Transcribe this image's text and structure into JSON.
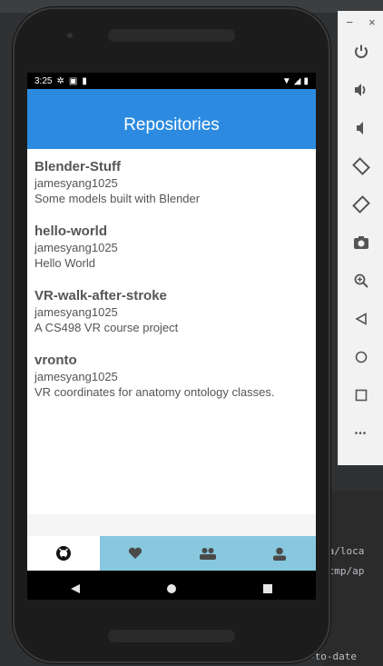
{
  "ide": {
    "log_lines": [
      "ta/loca",
      "/tmp/ap"
    ],
    "bottom_text": "-to-date"
  },
  "status_bar": {
    "time": "3:25"
  },
  "app_bar": {
    "title": "Repositories"
  },
  "repositories": [
    {
      "name": "Blender-Stuff",
      "owner": "jamesyang1025",
      "description": "Some models built with Blender"
    },
    {
      "name": "hello-world",
      "owner": "jamesyang1025",
      "description": "Hello World"
    },
    {
      "name": "VR-walk-after-stroke",
      "owner": "jamesyang1025",
      "description": "A CS498 VR course project"
    },
    {
      "name": "vronto",
      "owner": "jamesyang1025",
      "description": "VR coordinates for anatomy ontology classes."
    }
  ],
  "tabs": [
    {
      "icon": "github-icon",
      "active": true
    },
    {
      "icon": "heart-icon",
      "active": false
    },
    {
      "icon": "people-icon",
      "active": false
    },
    {
      "icon": "person-icon",
      "active": false
    }
  ],
  "nav": [
    "back-icon",
    "home-icon",
    "recents-icon"
  ],
  "toolbar": {
    "minimize": "−",
    "close": "×",
    "tools": [
      "power-icon",
      "volume-up-icon",
      "volume-down-icon",
      "rotate-left-icon",
      "rotate-right-icon",
      "screenshot-icon",
      "zoom-icon",
      "back-icon",
      "home-icon",
      "overview-icon",
      "more-icon"
    ],
    "more_label": "•••"
  },
  "colors": {
    "app_bar": "#2c8be0",
    "tab_bar": "#87c8df"
  }
}
